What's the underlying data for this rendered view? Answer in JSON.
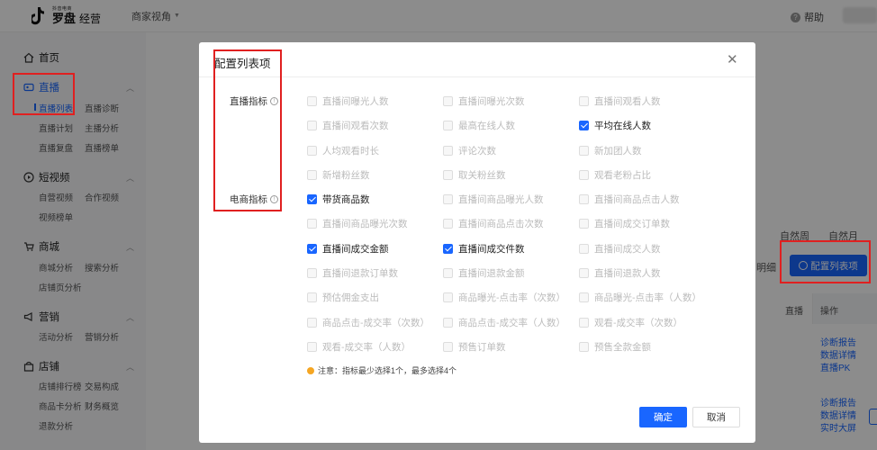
{
  "header": {
    "logo_small": "抖音电商",
    "logo_main": "罗盘",
    "logo_sub": "经营",
    "merchant_label": "商家视角",
    "help_label": "帮助"
  },
  "sidebar": {
    "home": "首页",
    "live": {
      "title": "直播",
      "items": [
        "直播列表",
        "直播诊断",
        "直播计划",
        "主播分析",
        "直播复盘",
        "直播榜单"
      ]
    },
    "video": {
      "title": "短视频",
      "items": [
        "自营视频",
        "合作视频",
        "视频榜单"
      ]
    },
    "shop": {
      "title": "商城",
      "items": [
        "商城分析",
        "搜索分析",
        "店铺页分析"
      ]
    },
    "marketing": {
      "title": "营销",
      "items": [
        "活动分析",
        "营销分析"
      ]
    },
    "store": {
      "title": "店铺",
      "items": [
        "店铺排行榜",
        "交易构成",
        "商品卡分析",
        "财务概览",
        "退款分析"
      ]
    }
  },
  "background": {
    "natural_week": "自然周",
    "natural_month": "自然月",
    "detail": "明细",
    "config_button": "配置列表项",
    "col_live": "直播",
    "col_action": "操作",
    "row1_links": [
      "诊断报告",
      "数据详情",
      "直播PK"
    ],
    "row2_links": [
      "诊断报告",
      "数据详情",
      "实时大屏"
    ]
  },
  "modal": {
    "title": "配置列表项",
    "live_section": "直播指标",
    "ecom_section": "电商指标",
    "live_options": [
      {
        "label": "直播间曝光人数",
        "checked": false
      },
      {
        "label": "直播间曝光次数",
        "checked": false
      },
      {
        "label": "直播间观看人数",
        "checked": false
      },
      {
        "label": "直播间观看次数",
        "checked": false
      },
      {
        "label": "最高在线人数",
        "checked": false
      },
      {
        "label": "平均在线人数",
        "checked": true
      },
      {
        "label": "人均观看时长",
        "checked": false
      },
      {
        "label": "评论次数",
        "checked": false
      },
      {
        "label": "新加团人数",
        "checked": false
      },
      {
        "label": "新增粉丝数",
        "checked": false
      },
      {
        "label": "取关粉丝数",
        "checked": false
      },
      {
        "label": "观看老粉占比",
        "checked": false
      }
    ],
    "ecom_options": [
      {
        "label": "带货商品数",
        "checked": true
      },
      {
        "label": "直播间商品曝光人数",
        "checked": false
      },
      {
        "label": "直播间商品点击人数",
        "checked": false
      },
      {
        "label": "直播间商品曝光次数",
        "checked": false
      },
      {
        "label": "直播间商品点击次数",
        "checked": false
      },
      {
        "label": "直播间成交订单数",
        "checked": false
      },
      {
        "label": "直播间成交金额",
        "checked": true
      },
      {
        "label": "直播间成交件数",
        "checked": true
      },
      {
        "label": "直播间成交人数",
        "checked": false
      },
      {
        "label": "直播间退款订单数",
        "checked": false
      },
      {
        "label": "直播间退款金额",
        "checked": false
      },
      {
        "label": "直播间退款人数",
        "checked": false
      },
      {
        "label": "预估佣金支出",
        "checked": false
      },
      {
        "label": "商品曝光-点击率（次数）",
        "checked": false
      },
      {
        "label": "商品曝光-点击率（人数）",
        "checked": false
      },
      {
        "label": "商品点击-成交率（次数）",
        "checked": false
      },
      {
        "label": "商品点击-成交率（人数）",
        "checked": false
      },
      {
        "label": "观看-成交率（次数）",
        "checked": false
      },
      {
        "label": "观看-成交率（人数）",
        "checked": false
      },
      {
        "label": "预售订单数",
        "checked": false
      },
      {
        "label": "预售全款金额",
        "checked": false
      }
    ],
    "note": "注意：指标最少选择1个，最多选择4个",
    "confirm": "确定",
    "cancel": "取消"
  },
  "colors": {
    "accent": "#1966ff",
    "annotation": "#e02020"
  }
}
